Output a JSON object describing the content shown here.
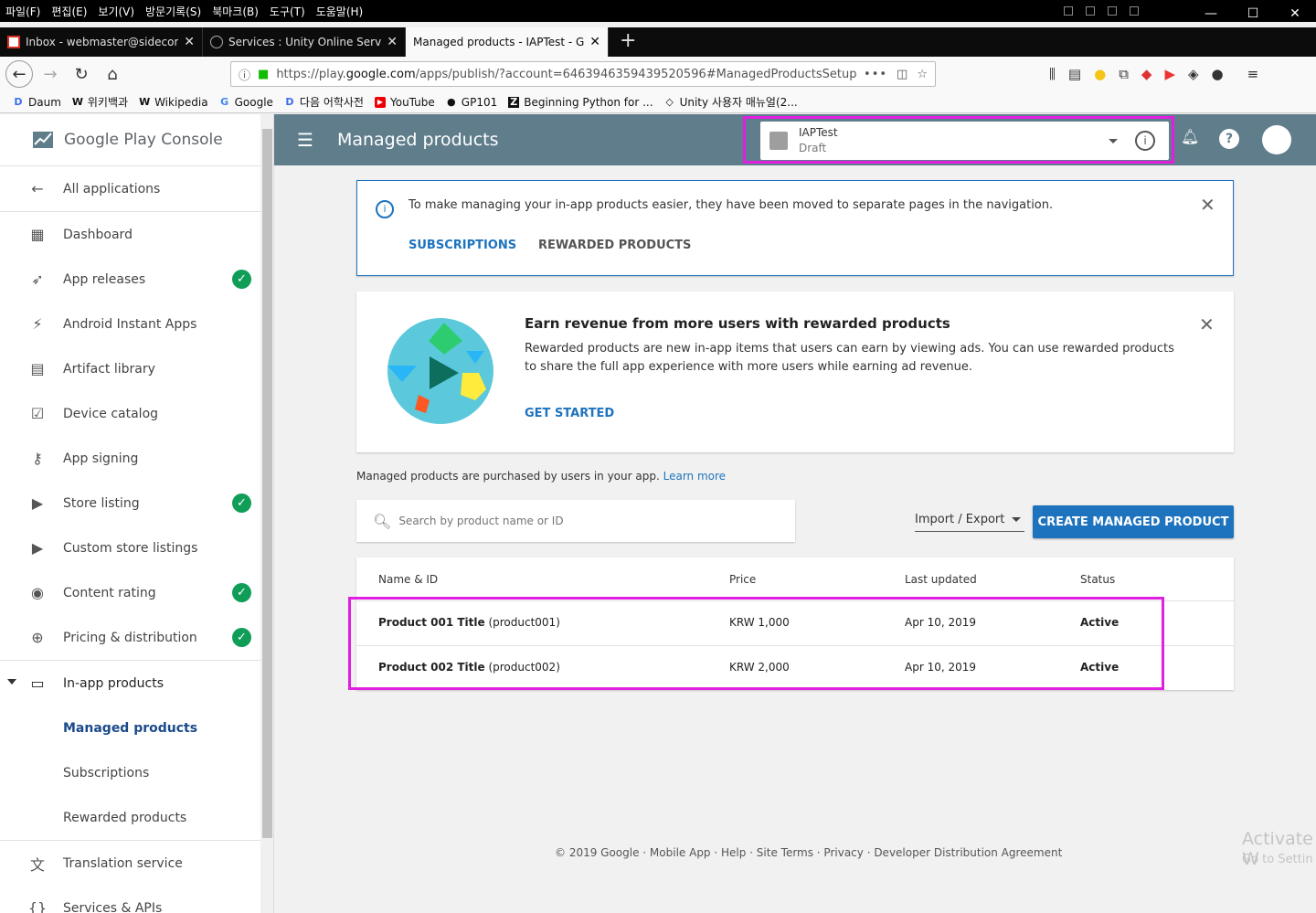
{
  "menubar": [
    "파일(F)",
    "편집(E)",
    "보기(V)",
    "방문기록(S)",
    "북마크(B)",
    "도구(T)",
    "도움말(H)"
  ],
  "tabs": [
    {
      "label": "Inbox - webmaster@sidecomm",
      "icon": "gmail-icon"
    },
    {
      "label": "Services : Unity Online Services",
      "icon": "unity-icon"
    },
    {
      "label": "Managed products - IAPTest - Goo",
      "icon": "none"
    }
  ],
  "url": {
    "prefix": "https://play.",
    "domain": "google.com",
    "rest": "/apps/publish/?account=6463946359439520596#ManagedProductsSetup"
  },
  "bookmarks": [
    "Daum",
    "위키백과",
    "Wikipedia",
    "Google",
    "다음 어학사전",
    "YouTube",
    "GP101",
    "Beginning Python for ...",
    "Unity 사용자 매뉴얼(2..."
  ],
  "console": {
    "logo_google": "Google Play",
    "logo_console": "Console",
    "header_title": "Managed products",
    "app_name": "IAPTest",
    "app_state": "Draft"
  },
  "sidebar": {
    "all_apps": "All applications",
    "items": [
      {
        "label": "Dashboard",
        "check": false
      },
      {
        "label": "App releases",
        "check": true
      },
      {
        "label": "Android Instant Apps",
        "check": false
      },
      {
        "label": "Artifact library",
        "check": false
      },
      {
        "label": "Device catalog",
        "check": false
      },
      {
        "label": "App signing",
        "check": false
      },
      {
        "label": "Store listing",
        "check": true
      },
      {
        "label": "Custom store listings",
        "check": false
      },
      {
        "label": "Content rating",
        "check": true
      },
      {
        "label": "Pricing & distribution",
        "check": true
      }
    ],
    "inapp": "In-app products",
    "sub": [
      "Managed products",
      "Subscriptions",
      "Rewarded products"
    ],
    "translation": "Translation service",
    "services": "Services & APIs"
  },
  "notice": {
    "text": "To make managing your in-app products easier, they have been moved to separate pages in the navigation.",
    "link1": "SUBSCRIPTIONS",
    "link2": "REWARDED PRODUCTS"
  },
  "earn": {
    "title": "Earn revenue from more users with rewarded products",
    "body": "Rewarded products are new in-app items that users can earn by viewing ads. You can use rewarded products to share the full app experience with more users while earning ad revenue.",
    "cta": "GET STARTED"
  },
  "intro": {
    "text": "Managed products are purchased by users in your app. ",
    "link": "Learn more"
  },
  "search_placeholder": "Search by product name or ID",
  "import_export": "Import / Export",
  "create_btn": "CREATE MANAGED PRODUCT",
  "table": {
    "headers": [
      "Name & ID",
      "Price",
      "Last updated",
      "Status"
    ],
    "rows": [
      {
        "title": "Product 001 Title",
        "id": " (product001)",
        "price": "KRW 1,000",
        "updated": "Apr 10, 2019",
        "status": "Active"
      },
      {
        "title": "Product 002 Title",
        "id": " (product002)",
        "price": "KRW 2,000",
        "updated": "Apr 10, 2019",
        "status": "Active"
      }
    ]
  },
  "footer": "© 2019 Google · Mobile App · Help · Site Terms · Privacy · Developer Distribution Agreement",
  "watermark": {
    "line1": "Activate W",
    "line2": "Go to Settin"
  },
  "colors": {
    "header": "#607d8b",
    "accent": "#1e73be",
    "check": "#0f9d58",
    "highlight": "#e020e0"
  }
}
